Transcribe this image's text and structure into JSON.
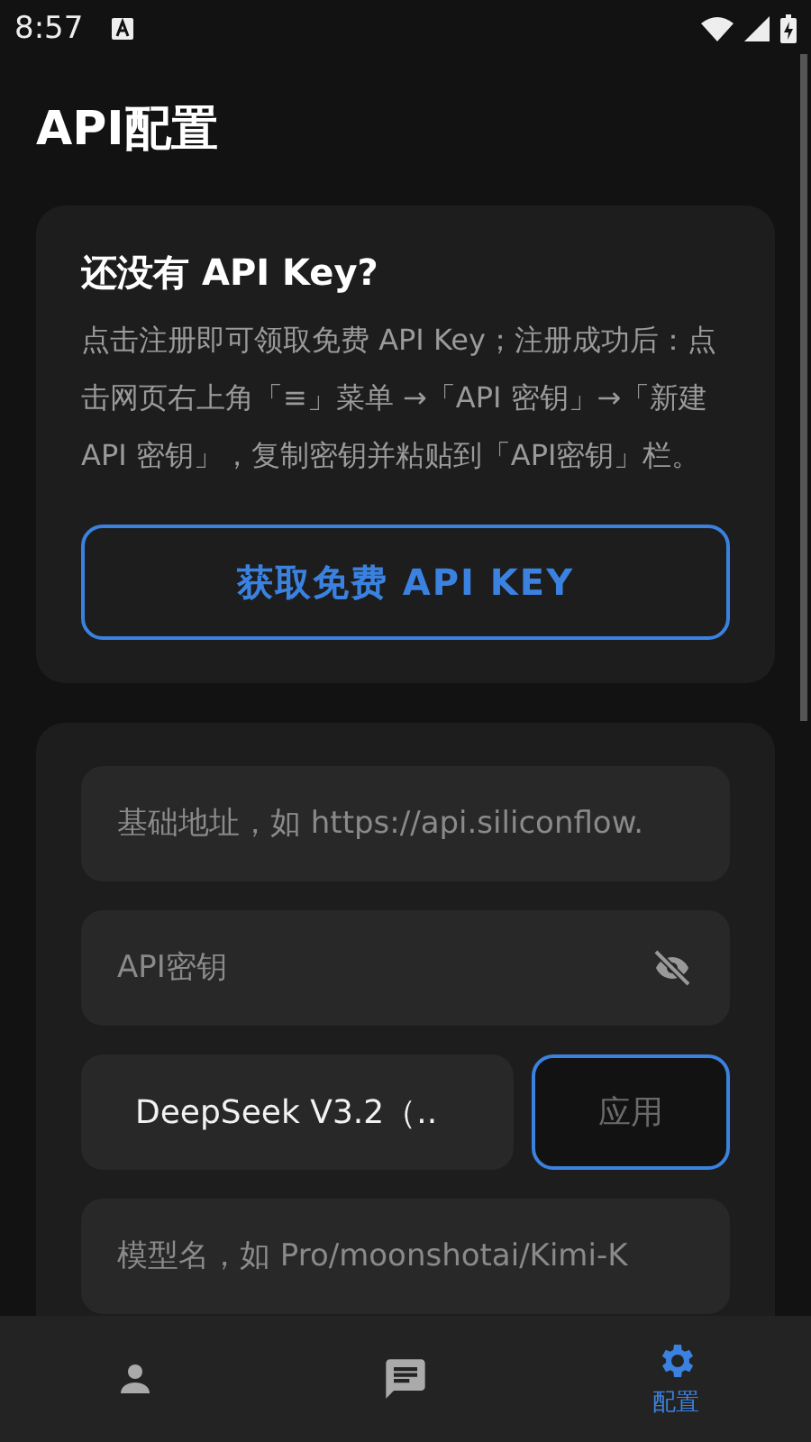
{
  "status_bar": {
    "time": "8:57"
  },
  "title": "API配置",
  "signup_card": {
    "heading": "还没有 API Key?",
    "body": "点击注册即可领取免费 API Key；注册成功后：点击网页右上角「≡」菜单 →「API 密钥」→「新建 API 密钥」，复制密钥并粘贴到「API密钥」栏。",
    "button": "获取免费 API KEY"
  },
  "config_card": {
    "base_url": {
      "placeholder": "基础地址，如 https://api.siliconflow."
    },
    "api_key": {
      "placeholder": "API密钥",
      "masked": true
    },
    "model_preset": {
      "value": "DeepSeek V3.2（.."
    },
    "apply_button": "应用",
    "model_name": {
      "placeholder": "模型名，如 Pro/moonshotai/Kimi-K"
    }
  },
  "bottom_nav": [
    {
      "kind": "profile",
      "selected": false
    },
    {
      "kind": "chat",
      "selected": false
    },
    {
      "kind": "settings",
      "selected": true,
      "label": "配置"
    }
  ]
}
